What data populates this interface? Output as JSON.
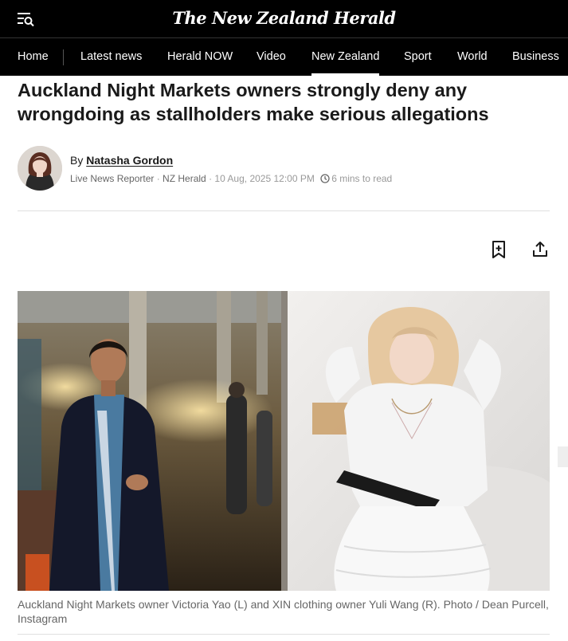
{
  "site": {
    "logo_text": "The New Zealand Herald"
  },
  "nav": {
    "items": [
      {
        "label": "Home"
      },
      {
        "label": "Latest news"
      },
      {
        "label": "Herald NOW"
      },
      {
        "label": "Video"
      },
      {
        "label": "New Zealand"
      },
      {
        "label": "Sport"
      },
      {
        "label": "World"
      },
      {
        "label": "Business"
      }
    ],
    "active": "New Zealand"
  },
  "article": {
    "headline": "Auckland Night Markets owners strongly deny any wrongdoing as stallholders make serious allegations",
    "byline_prefix": "By",
    "author": "Natasha Gordon",
    "author_role": "Live News Reporter",
    "publisher": "NZ Herald",
    "date": "10 Aug, 2025 12:00 PM",
    "read_time": "6 mins to read",
    "caption": "Auckland Night Markets owner Victoria Yao (L) and XIN clothing owner Yuli Wang (R). Photo / Dean Purcell, Instagram"
  },
  "icons": {
    "menu": "menu-search-icon",
    "clock": "clock-icon",
    "bookmark": "bookmark-add-icon",
    "share": "share-icon"
  },
  "colors": {
    "header_bg": "#000000",
    "text": "#1a1a1a",
    "meta": "#666666",
    "divider": "#e0e0e0"
  }
}
